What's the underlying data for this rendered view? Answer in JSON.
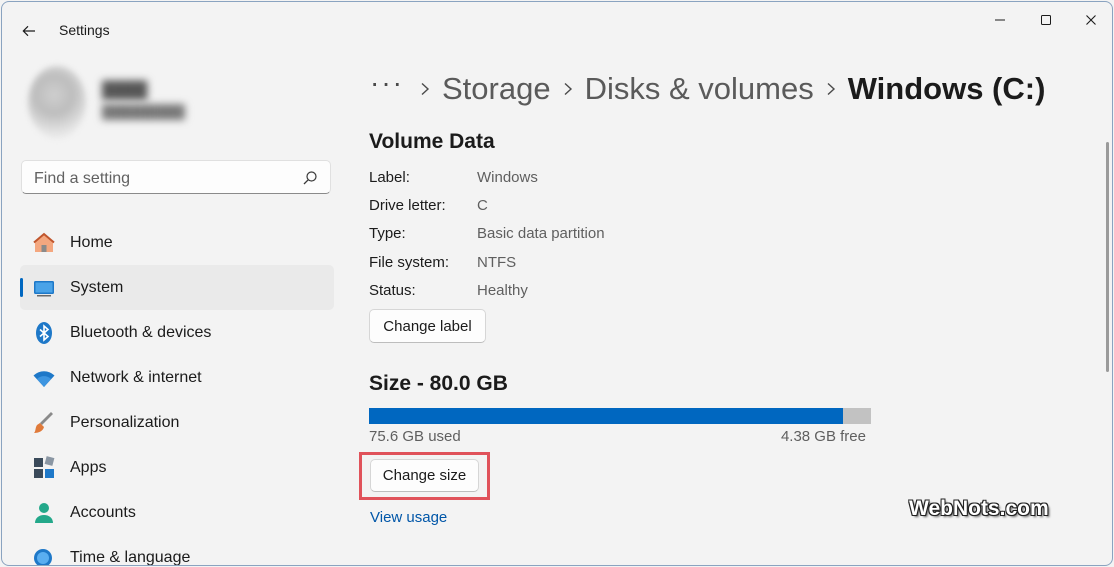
{
  "titlebar": {
    "title": "Settings"
  },
  "search": {
    "placeholder": "Find a setting"
  },
  "nav": {
    "items": [
      {
        "label": "Home",
        "icon": "home-icon"
      },
      {
        "label": "System",
        "icon": "system-icon",
        "active": true
      },
      {
        "label": "Bluetooth & devices",
        "icon": "bluetooth-icon"
      },
      {
        "label": "Network & internet",
        "icon": "network-icon"
      },
      {
        "label": "Personalization",
        "icon": "brush-icon"
      },
      {
        "label": "Apps",
        "icon": "apps-icon"
      },
      {
        "label": "Accounts",
        "icon": "accounts-icon"
      },
      {
        "label": "Time & language",
        "icon": "time-language-icon"
      }
    ]
  },
  "breadcrumb": {
    "more": "···",
    "items": [
      "Storage",
      "Disks & volumes"
    ],
    "current": "Windows (C:)"
  },
  "volume_data": {
    "title": "Volume Data",
    "properties": [
      {
        "label": "Label:",
        "value": "Windows"
      },
      {
        "label": "Drive letter:",
        "value": "C"
      },
      {
        "label": "Type:",
        "value": "Basic data partition"
      },
      {
        "label": "File system:",
        "value": "NTFS"
      },
      {
        "label": "Status:",
        "value": "Healthy"
      }
    ],
    "change_label_button": "Change label"
  },
  "size": {
    "title": "Size - 80.0 GB",
    "used_fraction": 0.945,
    "used_text": "75.6 GB used",
    "free_text": "4.38 GB free",
    "change_size_button": "Change size",
    "view_usage_link": "View usage"
  },
  "watermark": "WebNots.com",
  "colors": {
    "accent": "#0067c0",
    "highlight_box": "#e0525a",
    "link": "#0056a8"
  }
}
